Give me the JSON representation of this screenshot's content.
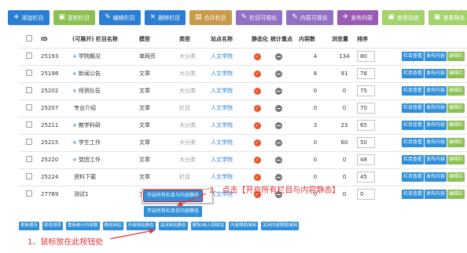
{
  "toolbar": {
    "add": {
      "icon": "+",
      "label": "添加栏目",
      "color": "#2a7fd4"
    },
    "copy": {
      "icon": "▣",
      "label": "复制栏目",
      "color": "#8cc152"
    },
    "edit": {
      "icon": "✎",
      "label": "编辑栏目",
      "color": "#2a7fd4"
    },
    "delete": {
      "icon": "✕",
      "label": "删除栏目",
      "color": "#2a7fd4"
    },
    "merge": {
      "icon": "▤",
      "label": "合并栏目",
      "color": "#c99a4a"
    },
    "visualize": {
      "icon": "✎",
      "label": "栏目可视化",
      "color": "#9270c4"
    },
    "content_visualize": {
      "icon": "✎",
      "label": "内容可视化",
      "color": "#9270c4"
    },
    "publish": {
      "icon": "✈",
      "label": "发布内容",
      "color": "#9b59b6"
    },
    "view_dynamic": {
      "icon": "▣",
      "label": "查看动态",
      "color": "#a3d36a"
    },
    "view_static": {
      "icon": "▣",
      "label": "查看静态",
      "color": "#a3d36a"
    }
  },
  "table": {
    "headers": [
      "",
      "ID",
      "(可展开) 栏目名称",
      "模型",
      "类型",
      "站点名称",
      "静态化",
      "统计重点",
      "内容数",
      "浏览量",
      "排序",
      ""
    ],
    "rows": [
      {
        "id": "25193",
        "plus": "+",
        "name": "学院概况",
        "model": "单网页",
        "type": "大分类",
        "site": "人文学院",
        "content_count": "4",
        "views": "134",
        "sort": "80"
      },
      {
        "id": "25198",
        "plus": "+",
        "name": "新闻公告",
        "model": "文章",
        "type": "大分类",
        "site": "人文学院",
        "content_count": "8",
        "views": "91",
        "sort": "78"
      },
      {
        "id": "25202",
        "plus": "+",
        "name": "师资队伍",
        "model": "文章",
        "type": "大分类",
        "site": "人文学院",
        "content_count": "0",
        "views": "0",
        "sort": "75"
      },
      {
        "id": "25207",
        "plus": "",
        "name": "专业介绍",
        "model": "文章",
        "type": "栏目",
        "site": "人文学院",
        "content_count": "0",
        "views": "0",
        "sort": "70"
      },
      {
        "id": "25211",
        "plus": "+",
        "name": "教学科研",
        "model": "文章",
        "type": "大分类",
        "site": "人文学院",
        "content_count": "3",
        "views": "23",
        "sort": "65"
      },
      {
        "id": "25215",
        "plus": "+",
        "name": "学生工作",
        "model": "文章",
        "type": "大分类",
        "site": "人文学院",
        "content_count": "0",
        "views": "60",
        "sort": "50"
      },
      {
        "id": "25220",
        "plus": "+",
        "name": "党团工作",
        "model": "文章",
        "type": "大分类",
        "site": "人文学院",
        "content_count": "0",
        "views": "0",
        "sort": "48"
      },
      {
        "id": "25224",
        "plus": "",
        "name": "资料下载",
        "model": "文章",
        "type": "栏目",
        "site": "人文学院",
        "content_count": "0",
        "views": "0",
        "sort": "45"
      },
      {
        "id": "27769",
        "plus": "",
        "name": "测试1",
        "model": "文章",
        "type": "栏目",
        "site": "人文学院",
        "content_count": "0",
        "views": "0",
        "sort": "0"
      }
    ],
    "row_buttons": [
      {
        "label": "栏目查看",
        "color": "#2f8fd8"
      },
      {
        "label": "发布内容",
        "color": "#2f8fd8"
      },
      {
        "label": "编辑栏",
        "color": "#8cc152"
      }
    ]
  },
  "popup": {
    "open_all": "开启所有栏目与内容静态",
    "open_column_only": "开启所有栏目仅内容静态"
  },
  "bottom_buttons": [
    "更新缓存",
    "修改排序",
    "重新统计内容数",
    "静态网站",
    "开启网站静态",
    "关闭网站静态",
    "删除/纳入回收站",
    "内容限局域网",
    "关闭内容限局域网"
  ],
  "annotations": {
    "step1": "1、鼠标放在此按钮处",
    "step2": "2、点击【开启所有栏目与内容静态】"
  }
}
